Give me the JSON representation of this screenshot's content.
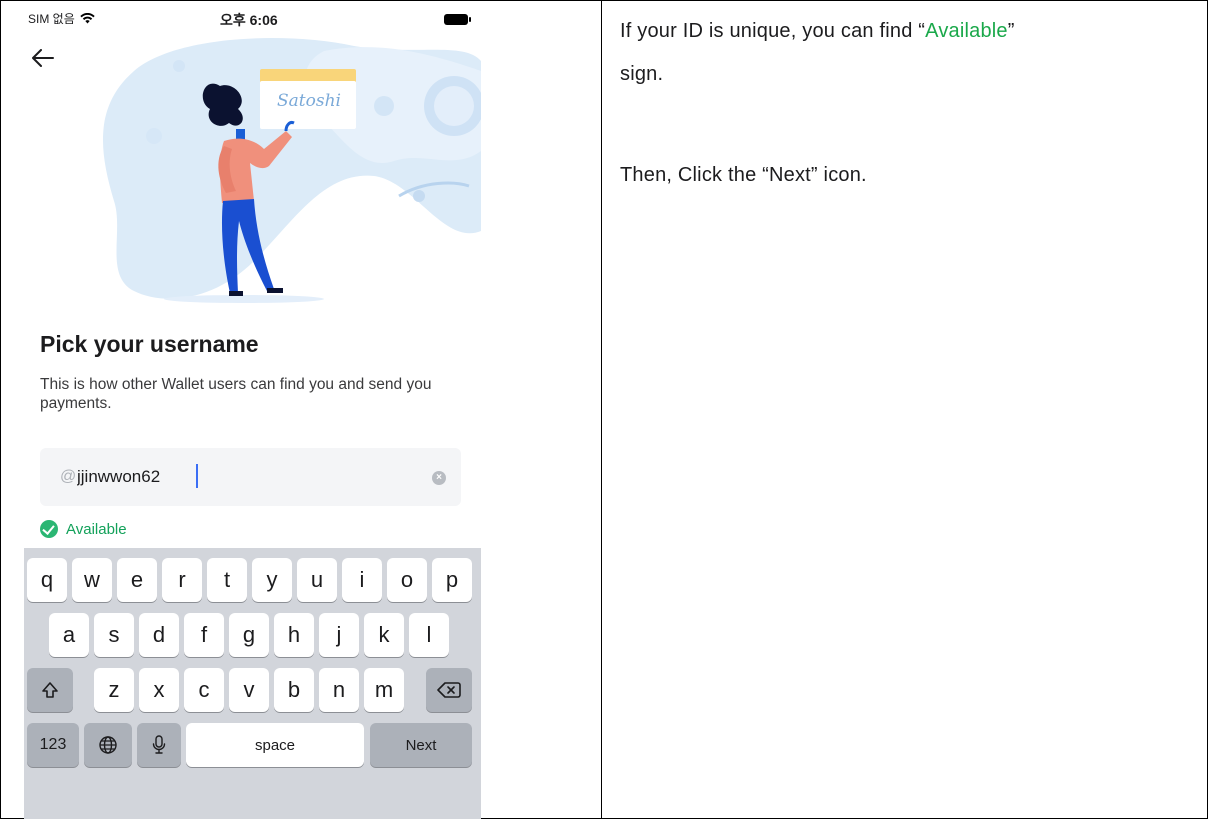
{
  "statusbar": {
    "carrier": "SIM 없음",
    "time": "오후 6:06"
  },
  "screen": {
    "back_icon": "arrow-left-icon",
    "illustration_text": "Satoshi",
    "title": "Pick your username",
    "subtitle": "This is how other Wallet users can find you and send you payments.",
    "input": {
      "prefix": "@",
      "value": "jjinwwon62",
      "clear_icon": "clear-icon"
    },
    "status": {
      "label": "Available",
      "color": "#2bb673"
    }
  },
  "keyboard": {
    "row1": [
      "q",
      "w",
      "e",
      "r",
      "t",
      "y",
      "u",
      "i",
      "o",
      "p"
    ],
    "row2": [
      "a",
      "s",
      "d",
      "f",
      "g",
      "h",
      "j",
      "k",
      "l"
    ],
    "row3": [
      "z",
      "x",
      "c",
      "v",
      "b",
      "n",
      "m"
    ],
    "shift_icon": "shift-icon",
    "backspace_icon": "backspace-icon",
    "numbers_label": "123",
    "globe_icon": "globe-icon",
    "mic_icon": "microphone-icon",
    "space_label": "space",
    "next_label": "Next"
  },
  "instructions": {
    "line1_prefix": "If your ID is unique, you can find “",
    "line1_highlight": "Available",
    "line1_suffix": "”",
    "line2": "sign.",
    "line3": "Then, Click the “Next” icon.",
    "highlight_color": "#1aa84a"
  }
}
